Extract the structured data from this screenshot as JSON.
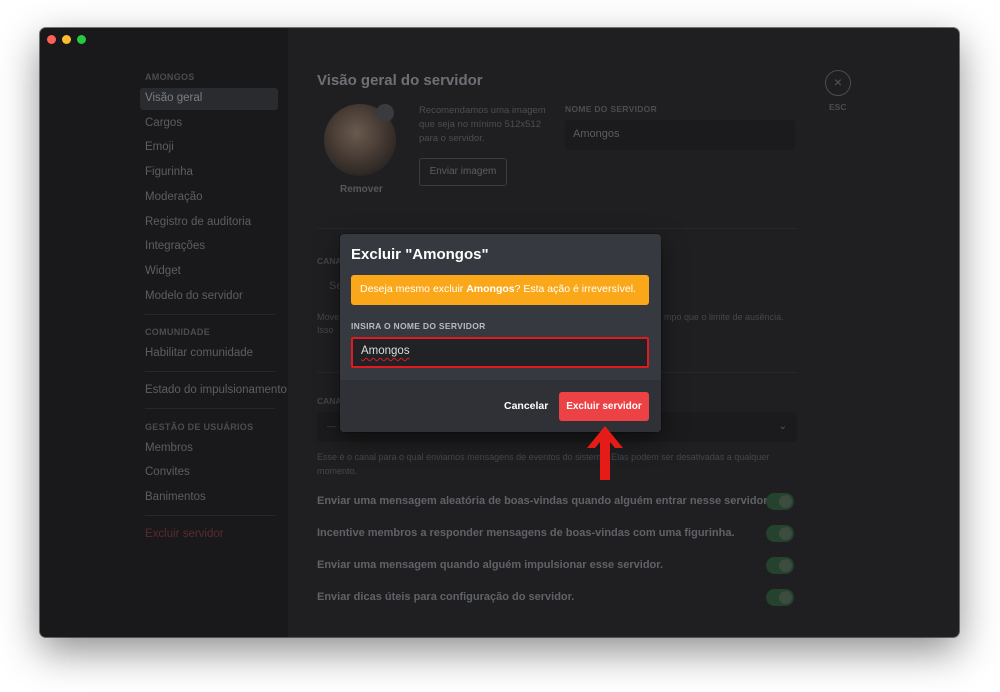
{
  "sidebar": {
    "sections": [
      {
        "title": "AMONGOS"
      },
      {
        "title": "COMUNIDADE"
      },
      {
        "title": "GESTÃO DE USUÁRIOS"
      }
    ],
    "items": [
      {
        "label": "Visão geral"
      },
      {
        "label": "Cargos"
      },
      {
        "label": "Emoji"
      },
      {
        "label": "Figurinha"
      },
      {
        "label": "Moderação"
      },
      {
        "label": "Registro de auditoria"
      },
      {
        "label": "Integrações"
      },
      {
        "label": "Widget"
      },
      {
        "label": "Modelo do servidor"
      },
      {
        "label": "Habilitar comunidade"
      },
      {
        "label": "Estado do impulsionamento"
      },
      {
        "label": "Membros"
      },
      {
        "label": "Convites"
      },
      {
        "label": "Banimentos"
      },
      {
        "label": "Excluir servidor"
      }
    ]
  },
  "main": {
    "title": "Visão geral do servidor",
    "remove_label": "Remover",
    "recommend_text": "Recomendamos uma imagem que seja no mínimo 512x512 para o servidor.",
    "upload_label": "Enviar imagem",
    "server_name_label": "NOME DO SERVIDOR",
    "server_name_value": "Amongos",
    "close_label": "×",
    "esc_label": "ESC",
    "fragments": {
      "canal_1": "CANA",
      "se": "Se",
      "move_1": "Move",
      "isso": "Isso",
      "canal_2": "CANA",
      "dash": "—",
      "afk_tail": "mpo que o limite de ausência.",
      "system_desc_1": "Esse é o canal para o qual enviamos mensagens de eventos do sistema. Elas podem ser desativadas a qualquer",
      "system_desc_2": "momento."
    },
    "toggles": [
      {
        "label": "Enviar uma mensagem aleatória de boas-vindas quando alguém entrar nesse servidor."
      },
      {
        "label": "Incentive membros a responder mensagens de boas-vindas com uma figurinha."
      },
      {
        "label": "Enviar uma mensagem quando alguém impulsionar esse servidor."
      },
      {
        "label": "Enviar dicas úteis para configuração do servidor."
      }
    ]
  },
  "modal": {
    "title": "Excluir \"Amongos\"",
    "warning_pre": "Deseja mesmo excluir ",
    "warning_name": "Amongos",
    "warning_post": "? Esta ação é irreversível.",
    "input_label": "INSIRA O NOME DO SERVIDOR",
    "input_value": "Amongos",
    "cancel_label": "Cancelar",
    "delete_label": "Excluir servidor"
  },
  "colors": {
    "danger": "#ed4245",
    "warning": "#faa81a",
    "arrow": "#e41b17",
    "modal_bg": "#36393f"
  }
}
